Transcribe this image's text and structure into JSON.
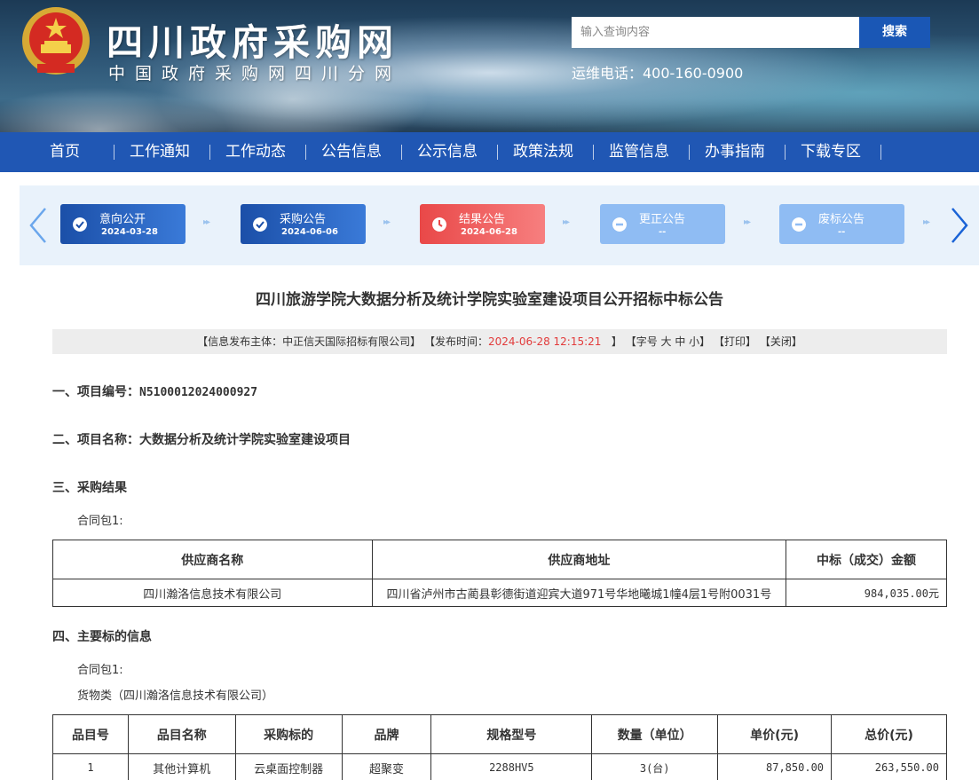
{
  "header": {
    "title": "四川政府采购网",
    "subtitle": "中国政府采购网四川分网",
    "search_placeholder": "输入查询内容",
    "search_button": "搜索",
    "hotline": "运维电话：400-160-0900"
  },
  "nav": [
    "首页",
    "工作通知",
    "工作动态",
    "公告信息",
    "公示信息",
    "政策法规",
    "监管信息",
    "办事指南",
    "下载专区"
  ],
  "steps": [
    {
      "name": "意向公开",
      "date": "2024-03-28",
      "state": "done"
    },
    {
      "name": "采购公告",
      "date": "2024-06-06",
      "state": "done"
    },
    {
      "name": "结果公告",
      "date": "2024-06-28",
      "state": "current"
    },
    {
      "name": "更正公告",
      "date": "--",
      "state": "none"
    },
    {
      "name": "废标公告",
      "date": "--",
      "state": "none"
    }
  ],
  "article": {
    "title": "四川旅游学院大数据分析及统计学院实验室建设项目公开招标中标公告",
    "meta": {
      "publisher": "【信息发布主体：中正信天国际招标有限公司】",
      "time_label": "【发布时间：",
      "time_value": "2024-06-28 12:15:21",
      "time_close": "】",
      "font_size": "【字号 大 中 小】",
      "print": "【打印】",
      "close": "【关闭】"
    },
    "section1_label": "一、项目编号：",
    "section1_value": "N5100012024000927",
    "section2": "二、项目名称：大数据分析及统计学院实验室建设项目",
    "section3": "三、采购结果",
    "package1": "合同包1:",
    "result_table": {
      "headers": [
        "供应商名称",
        "供应商地址",
        "中标（成交）金额"
      ],
      "rows": [
        [
          "四川瀚洛信息技术有限公司",
          "四川省泸州市古蔺县彰德街道迎宾大道971号华地曦城1幢4层1号附0031号",
          "984,035.00元"
        ]
      ]
    },
    "section4": "四、主要标的信息",
    "package1b": "合同包1:",
    "goods_category": "货物类（四川瀚洛信息技术有限公司）",
    "goods_table": {
      "headers": [
        "品目号",
        "品目名称",
        "采购标的",
        "品牌",
        "规格型号",
        "数量（单位）",
        "单价(元)",
        "总价(元)"
      ],
      "rows": [
        [
          "1",
          "其他计算机",
          "云桌面控制器",
          "超聚变",
          "2288HV5",
          "3(台)",
          "87,850.00",
          "263,550.00"
        ]
      ]
    }
  },
  "colors": {
    "nav_blue": "#2057b4",
    "step_blue": "#1b4fa8",
    "step_red": "#e94848",
    "step_light": "#8fbcf3",
    "meta_red": "#e23b3b"
  }
}
